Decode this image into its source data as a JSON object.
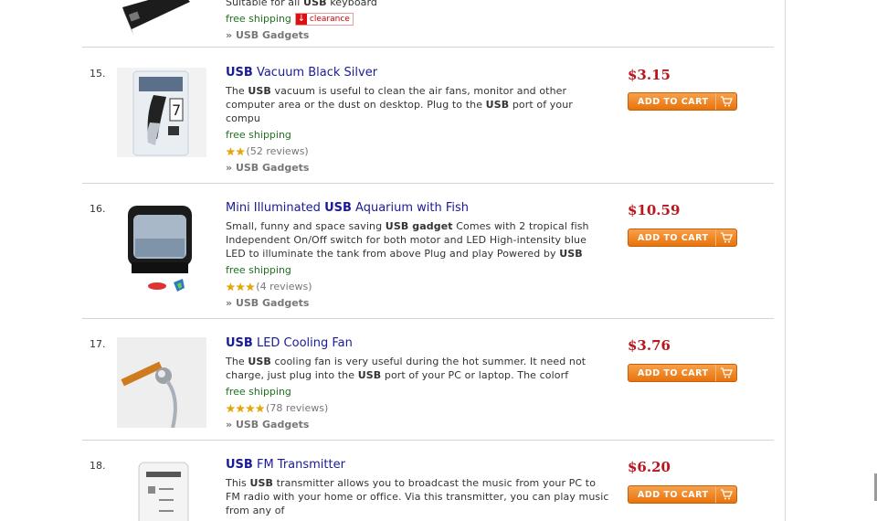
{
  "items": [
    {
      "number": "",
      "desc_tail": "Suitable for all ",
      "desc_bold": "USB",
      "desc_end": " keyboard",
      "shipping": "free shipping",
      "badge": "clearance",
      "category_prefix": "» ",
      "category": "USB Gadgets"
    },
    {
      "number": "15.",
      "title_bold": "USB",
      "title_rest": " Vacuum Black Silver",
      "desc_parts": [
        "The ",
        "USB",
        " vacuum is useful to clean the air fans, monitor and other computer area or the dust on desktop. Plug to the ",
        "USB",
        " port of your compu"
      ],
      "shipping": "free shipping",
      "stars": 2,
      "reviews": "(52 reviews)",
      "category_prefix": "» ",
      "category": "USB Gadgets",
      "price": "$3.15",
      "cart_label": "ADD TO CART"
    },
    {
      "number": "16.",
      "title_pre": "Mini Illuminated ",
      "title_bold": "USB",
      "title_rest": " Aquarium with Fish",
      "desc_parts": [
        "Small, funny and space saving ",
        "USB gadget",
        " Comes with 2 tropical fish Independent On/Off switch for both motor and LED High-intensity blue LED to illuminate the tank from above Plug and play Powered by ",
        "USB",
        ""
      ],
      "shipping": "free shipping",
      "stars": 3,
      "reviews": "(4 reviews)",
      "category_prefix": "» ",
      "category": "USB Gadgets",
      "price": "$10.59",
      "cart_label": "ADD TO CART"
    },
    {
      "number": "17.",
      "title_bold": "USB",
      "title_rest": " LED Cooling Fan",
      "desc_parts": [
        "The ",
        "USB",
        " cooling fan is very useful during the hot summer. It need not charge, just plug into the ",
        "USB",
        " port of your PC or laptop. The colorf"
      ],
      "shipping": "free shipping",
      "stars": 4,
      "reviews": "(78 reviews)",
      "category_prefix": "» ",
      "category": "USB Gadgets",
      "price": "$3.76",
      "cart_label": "ADD TO CART"
    },
    {
      "number": "18.",
      "title_bold": "USB",
      "title_rest": " FM Transmitter",
      "desc_parts": [
        "This ",
        "USB",
        " transmitter allows you to broadcast the music from your PC to FM radio with your home or office. Via this transmitter, you can play music from any of",
        "",
        ""
      ],
      "price": "$6.20",
      "cart_label": "ADD TO CART"
    }
  ],
  "colors": {
    "price": "#b8151d",
    "link": "#1a1a99",
    "shipping": "#207020",
    "cart": "#f08a2a"
  }
}
